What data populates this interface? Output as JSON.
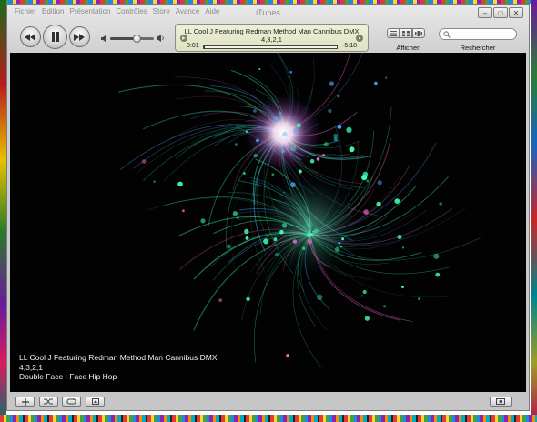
{
  "app": {
    "title": "iTunes"
  },
  "menu": {
    "items": [
      "Fichier",
      "Edition",
      "Présentation",
      "Contrôles",
      "Store",
      "Avancé",
      "Aide"
    ]
  },
  "window_controls": {
    "minimize": "–",
    "maximize": "□",
    "close": "✕"
  },
  "now_playing": {
    "artist": "LL Cool J Featuring Redman Method Man Cannibus DMX",
    "title": "4,3,2,1",
    "elapsed": "0:01",
    "remaining": "-5:18",
    "progress": 0.003
  },
  "volume": {
    "level": 0.6
  },
  "view": {
    "label": "Afficher"
  },
  "search": {
    "label": "Rechercher",
    "placeholder": ""
  },
  "visualizer": {
    "line1": "LL Cool J Featuring Redman Method Man Cannibus DMX",
    "line2": "4,3,2,1",
    "line3": "Double Face I Face Hip Hop"
  },
  "colors": {
    "lcd_background": "#e4e6c8",
    "visualizer_background": "#020203",
    "particle_green": "#3dffb0",
    "particle_blue": "#4aa8ff",
    "particle_pink": "#ff6fd6",
    "glow": "#fff6ff"
  },
  "icons": {
    "previous": "rewind-icon",
    "play_pause": "pause-icon",
    "next": "fast-forward-icon",
    "volume_low": "speaker-low-icon",
    "volume_high": "speaker-high-icon",
    "search": "magnifier-icon",
    "add": "plus-icon",
    "shuffle": "shuffle-icon",
    "repeat": "repeat-icon",
    "artwork": "artwork-icon",
    "visualizer_toggle": "visualizer-icon"
  }
}
